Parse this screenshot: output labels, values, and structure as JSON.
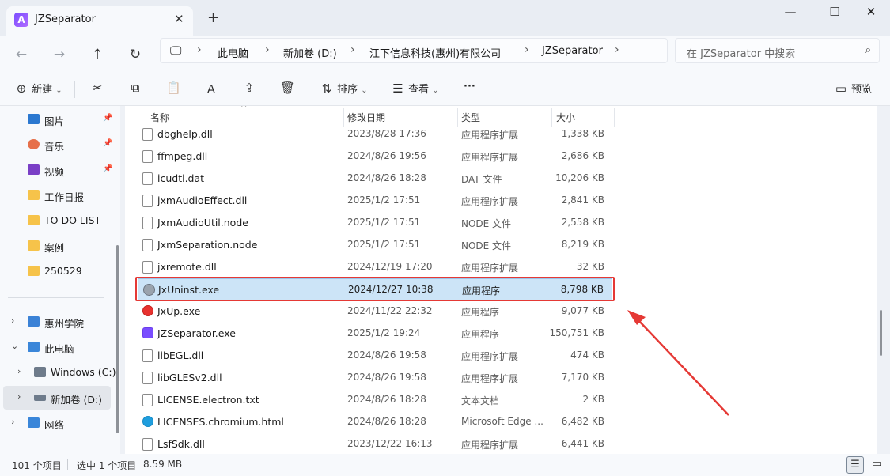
{
  "window": {
    "tab_title": "JZSeparator",
    "tab_icon_letter": "A",
    "close_glyph": "✕",
    "new_tab_glyph": "+",
    "min_glyph": "—",
    "max_glyph": "☐",
    "winclose_glyph": "✕"
  },
  "address": {
    "computer_glyph": "🖵",
    "crumbs": [
      "此电脑",
      "新加卷 (D:)",
      "江下信息科技(惠州)有限公司",
      "JZSeparator"
    ],
    "sep": "›",
    "search_placeholder": "在 JZSeparator 中搜索",
    "search_glyph": "⌕"
  },
  "nav": {
    "back": "←",
    "forward": "→",
    "up": "↑",
    "refresh": "↻"
  },
  "toolbar": {
    "new_label": "新建",
    "new_glyph": "⊕",
    "cut_glyph": "✂",
    "copy_glyph": "⧉",
    "paste_glyph": "📋",
    "rename_glyph": "Ａ",
    "share_glyph": "⇪",
    "delete_glyph": "🗑",
    "sort_label": "排序",
    "sort_glyph": "⇅",
    "view_label": "查看",
    "view_glyph": "☰",
    "more_glyph": "···",
    "dropdown_glyph": "⌄",
    "preview_label": "预览",
    "preview_glyph": "▭"
  },
  "sidebar": {
    "pinned": [
      {
        "label": "图片",
        "icon": "pictures",
        "color": "#2b78d0",
        "pin": "📌"
      },
      {
        "label": "音乐",
        "icon": "music",
        "color": "#e6704a",
        "pin": "📌"
      },
      {
        "label": "视频",
        "icon": "videos",
        "color": "#7a3fc6",
        "pin": "📌"
      },
      {
        "label": "工作日报",
        "icon": "folder",
        "color": "#f6c34a"
      },
      {
        "label": "TO DO LIST",
        "icon": "folder",
        "color": "#f6c34a"
      },
      {
        "label": "案例",
        "icon": "folder",
        "color": "#f6c34a"
      },
      {
        "label": "250529",
        "icon": "folder",
        "color": "#f6c34a"
      }
    ],
    "tree": [
      {
        "label": "惠州学院",
        "chev": "›",
        "color": "#3b82d6"
      },
      {
        "label": "此电脑",
        "chev": "⌄",
        "color": "#3a86d9"
      },
      {
        "label": "Windows (C:)",
        "chev": "›",
        "color": "#6e7b8b"
      },
      {
        "label": "新加卷 (D:)",
        "chev": "›",
        "color": "#6e7b8b"
      },
      {
        "label": "网络",
        "chev": "›",
        "color": "#3a86d9"
      }
    ]
  },
  "columns": {
    "name": "名称",
    "date": "修改日期",
    "type": "类型",
    "size": "大小",
    "sort_glyph": "^"
  },
  "files": [
    {
      "name": "dbghelp.dll",
      "date": "2023/8/28 17:36",
      "type": "应用程序扩展",
      "size": "1,338 KB",
      "icon": "dll"
    },
    {
      "name": "ffmpeg.dll",
      "date": "2024/8/26 19:56",
      "type": "应用程序扩展",
      "size": "2,686 KB",
      "icon": "dll"
    },
    {
      "name": "icudtl.dat",
      "date": "2024/8/26 18:28",
      "type": "DAT 文件",
      "size": "10,206 KB",
      "icon": "file"
    },
    {
      "name": "jxmAudioEffect.dll",
      "date": "2025/1/2 17:51",
      "type": "应用程序扩展",
      "size": "2,841 KB",
      "icon": "dll"
    },
    {
      "name": "JxmAudioUtil.node",
      "date": "2025/1/2 17:51",
      "type": "NODE 文件",
      "size": "2,558 KB",
      "icon": "file"
    },
    {
      "name": "JxmSeparation.node",
      "date": "2025/1/2 17:51",
      "type": "NODE 文件",
      "size": "8,219 KB",
      "icon": "file"
    },
    {
      "name": "jxremote.dll",
      "date": "2024/12/19 17:20",
      "type": "应用程序扩展",
      "size": "32 KB",
      "icon": "dll"
    },
    {
      "name": "JxUninst.exe",
      "date": "2024/12/27 10:38",
      "type": "应用程序",
      "size": "8,798 KB",
      "icon": "uninstaller",
      "selected": true
    },
    {
      "name": "JxUp.exe",
      "date": "2024/11/22 22:32",
      "type": "应用程序",
      "size": "9,077 KB",
      "icon": "updater"
    },
    {
      "name": "JZSeparator.exe",
      "date": "2025/1/2 19:24",
      "type": "应用程序",
      "size": "150,751 KB",
      "icon": "app"
    },
    {
      "name": "libEGL.dll",
      "date": "2024/8/26 19:58",
      "type": "应用程序扩展",
      "size": "474 KB",
      "icon": "dll"
    },
    {
      "name": "libGLESv2.dll",
      "date": "2024/8/26 19:58",
      "type": "应用程序扩展",
      "size": "7,170 KB",
      "icon": "dll"
    },
    {
      "name": "LICENSE.electron.txt",
      "date": "2024/8/26 18:28",
      "type": "文本文档",
      "size": "2 KB",
      "icon": "text"
    },
    {
      "name": "LICENSES.chromium.html",
      "date": "2024/8/26 18:28",
      "type": "Microsoft Edge ...",
      "size": "6,482 KB",
      "icon": "edge"
    },
    {
      "name": "LsfSdk.dll",
      "date": "2023/12/22 16:13",
      "type": "应用程序扩展",
      "size": "6,441 KB",
      "icon": "dll"
    }
  ],
  "status": {
    "count": "101 个项目",
    "selection": "选中 1 个项目",
    "size": "8.59 MB",
    "details_glyph": "☰",
    "tiles_glyph": "▭"
  },
  "colors": {
    "highlight": "#e53935",
    "selection": "#cce4f7"
  }
}
